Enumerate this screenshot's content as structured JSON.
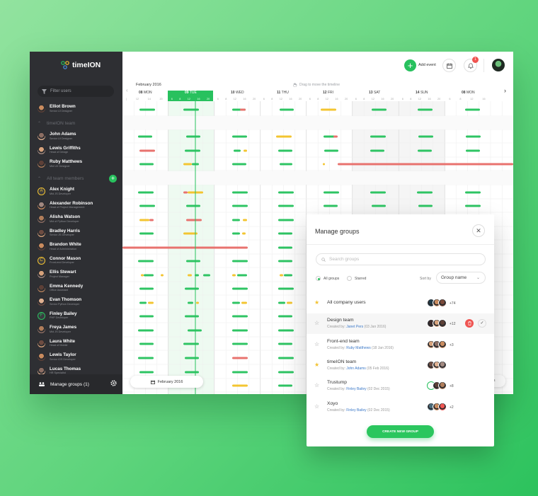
{
  "app": {
    "name": "timeION",
    "colors": {
      "accent": "#28c15e",
      "danger": "#ef5552",
      "warning": "#f2c230",
      "sidebar": "#2e2f33"
    }
  },
  "sidebar": {
    "filter_placeholder": "Filter users",
    "me": {
      "name": "Elliot Brown",
      "role": "Senior UI Designer"
    },
    "team_section": "timeION team",
    "team": [
      {
        "name": "John Adams",
        "role": "Senior UI Designer"
      },
      {
        "name": "Lewis Griffiths",
        "role": "Head of Design"
      },
      {
        "name": "Ruby Matthews",
        "role": "Mid UX Designer"
      }
    ],
    "members_section": "All team members",
    "members": [
      {
        "name": "Alex Knight",
        "role": "Mid JS Developer"
      },
      {
        "name": "Alexander Robinson",
        "role": "Head of Project Management"
      },
      {
        "name": "Alisha Watson",
        "role": "Mid of Python Developer"
      },
      {
        "name": "Bradley Harris",
        "role": "Senior JS Developer"
      },
      {
        "name": "Brandon White",
        "role": "Head of Administration"
      },
      {
        "name": "Connor Mason",
        "role": "Front-end Developer"
      },
      {
        "name": "Ellis Stewart",
        "role": "Project Manager"
      },
      {
        "name": "Emma Kennedy",
        "role": "Office Assistant"
      },
      {
        "name": "Evan Thomson",
        "role": "Senior Python Developer"
      },
      {
        "name": "Finley Bailey",
        "role": "PHP Developer"
      },
      {
        "name": "Freya James",
        "role": "Mid JS Developer"
      },
      {
        "name": "Laura White",
        "role": "Head of Mobile"
      },
      {
        "name": "Lewis Taylor",
        "role": "Senior iOS Developer"
      },
      {
        "name": "Lucas Thomas",
        "role": "HR Specialist"
      }
    ],
    "footer": "Manage groups (1)"
  },
  "topbar": {
    "add_event": "Add event",
    "notification_count": "1",
    "month": "February 2016",
    "drag_hint": "Drag to move the timeline"
  },
  "days": [
    {
      "num": "08",
      "name": "MON",
      "hours": [
        "|",
        "12",
        "14",
        "20"
      ]
    },
    {
      "num": "09",
      "name": "TUE",
      "hours": [
        "6",
        "8",
        "12",
        "16",
        "20"
      ],
      "selected": true
    },
    {
      "num": "10",
      "name": "WED",
      "hours": [
        "6",
        "8",
        "12",
        "16",
        "20"
      ]
    },
    {
      "num": "11",
      "name": "THU",
      "hours": [
        "6",
        "8",
        "12",
        "16",
        "20"
      ]
    },
    {
      "num": "12",
      "name": "FRI",
      "hours": [
        "6",
        "8",
        "12",
        "16",
        "20"
      ]
    },
    {
      "num": "13",
      "name": "SAT",
      "hours": [
        "6",
        "8",
        "12",
        "16",
        "20"
      ]
    },
    {
      "num": "14",
      "name": "SUN",
      "hours": [
        "6",
        "8",
        "12",
        "16",
        "20"
      ]
    },
    {
      "num": "08",
      "name": "MON",
      "hours": [
        "6",
        "8",
        "12",
        "16"
      ]
    }
  ],
  "date_button": "February 2016",
  "peek_text": "ks",
  "modal": {
    "title": "Manage groups",
    "search_placeholder": "Search groups",
    "filter_all": "All groups",
    "filter_starred": "Starred",
    "sort_label": "Sort by",
    "sort_value": "Group name",
    "groups": [
      {
        "name": "All company users",
        "created_prefix": "",
        "author": "",
        "date": "",
        "count": "+74",
        "starred": true
      },
      {
        "name": "Design team",
        "created_prefix": "Created by:",
        "author": "Janet Pers",
        "date": "(03 Jan 2016)",
        "count": "+12",
        "starred": false
      },
      {
        "name": "Front-end team",
        "created_prefix": "Created by:",
        "author": "Ruby Matthews",
        "date": "(18 Jan 2016)",
        "count": "+3",
        "starred": false
      },
      {
        "name": "timeION team",
        "created_prefix": "Created by:",
        "author": "John Adams",
        "date": "(05 Feb 2016)",
        "count": "",
        "starred": true
      },
      {
        "name": "Trustump",
        "created_prefix": "Created by:",
        "author": "Finley Bailey",
        "date": "(02 Dec 2015)",
        "count": "+8",
        "starred": false
      },
      {
        "name": "Xoyo",
        "created_prefix": "Created by:",
        "author": "Finley Bailey",
        "date": "(02 Dec 2015)",
        "count": "+2",
        "starred": false
      }
    ],
    "create_button": "CREATE NEW GROUP"
  }
}
